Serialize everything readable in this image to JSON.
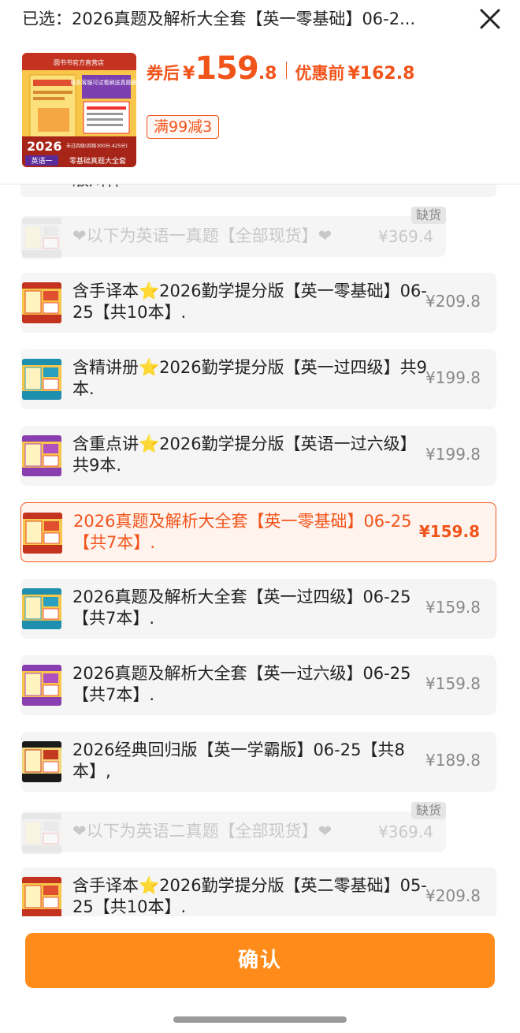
{
  "header": {
    "selected_text": "已选：2026真题及解析大全套【英一零基础】06-2...",
    "close_icon": "close-x-icon"
  },
  "product": {
    "after_coupon_label": "券后",
    "currency": "¥",
    "price_int": "159",
    "price_dec": ".8",
    "before_label": "优惠前",
    "before_price": "¥162.8",
    "coupon": "满99减3",
    "image_texts": {
      "shop": "圆书书官方直营店",
      "banner": "联系客服可试看刷送真题解析",
      "year": "2026",
      "subject": "英语一",
      "series": "零基础真题大全套",
      "level": "未过四级(四级300分-425分)"
    }
  },
  "options": [
    {
      "name": "❤以下为英语一真题【全部现货】❤",
      "price": "¥369.4",
      "status": "缺货",
      "disabled": true,
      "selected": false,
      "cover": "gray"
    },
    {
      "name": "含手译本⭐2026勤学提分版【英一零基础】06-25【共10本】.",
      "price": "¥209.8",
      "disabled": false,
      "selected": false,
      "cover": "red"
    },
    {
      "name": "含精讲册⭐2026勤学提分版【英一过四级】共9本.",
      "price": "¥199.8",
      "disabled": false,
      "selected": false,
      "cover": "teal"
    },
    {
      "name": "含重点讲⭐2026勤学提分版【英语一过六级】共9本.",
      "price": "¥199.8",
      "disabled": false,
      "selected": false,
      "cover": "purple"
    },
    {
      "name": "2026真题及解析大全套【英一零基础】06-25【共7本】.",
      "price": "¥159.8",
      "disabled": false,
      "selected": true,
      "cover": "red"
    },
    {
      "name": "2026真题及解析大全套【英一过四级】06-25【共7本】.",
      "price": "¥159.8",
      "disabled": false,
      "selected": false,
      "cover": "teal"
    },
    {
      "name": "2026真题及解析大全套【英一过六级】06-25【共7本】.",
      "price": "¥159.8",
      "disabled": false,
      "selected": false,
      "cover": "purple"
    },
    {
      "name": "2026经典回归版【英一学霸版】06-25【共8本】,",
      "price": "¥189.8",
      "disabled": false,
      "selected": false,
      "cover": "dark"
    },
    {
      "name": "❤以下为英语二真题【全部现货】❤",
      "price": "¥369.4",
      "status": "缺货",
      "disabled": true,
      "selected": false,
      "cover": "gray"
    },
    {
      "name": "含手译本⭐2026勤学提分版【英二零基础】05-25【共10本】.",
      "price": "¥209.8",
      "disabled": false,
      "selected": false,
      "cover": "red"
    }
  ],
  "partial_option_text": "版川杆",
  "confirm_label": "确认",
  "colors": {
    "accent": "#f1541b",
    "button": "#ff8c1a",
    "option_bg": "#f5f5f5"
  }
}
